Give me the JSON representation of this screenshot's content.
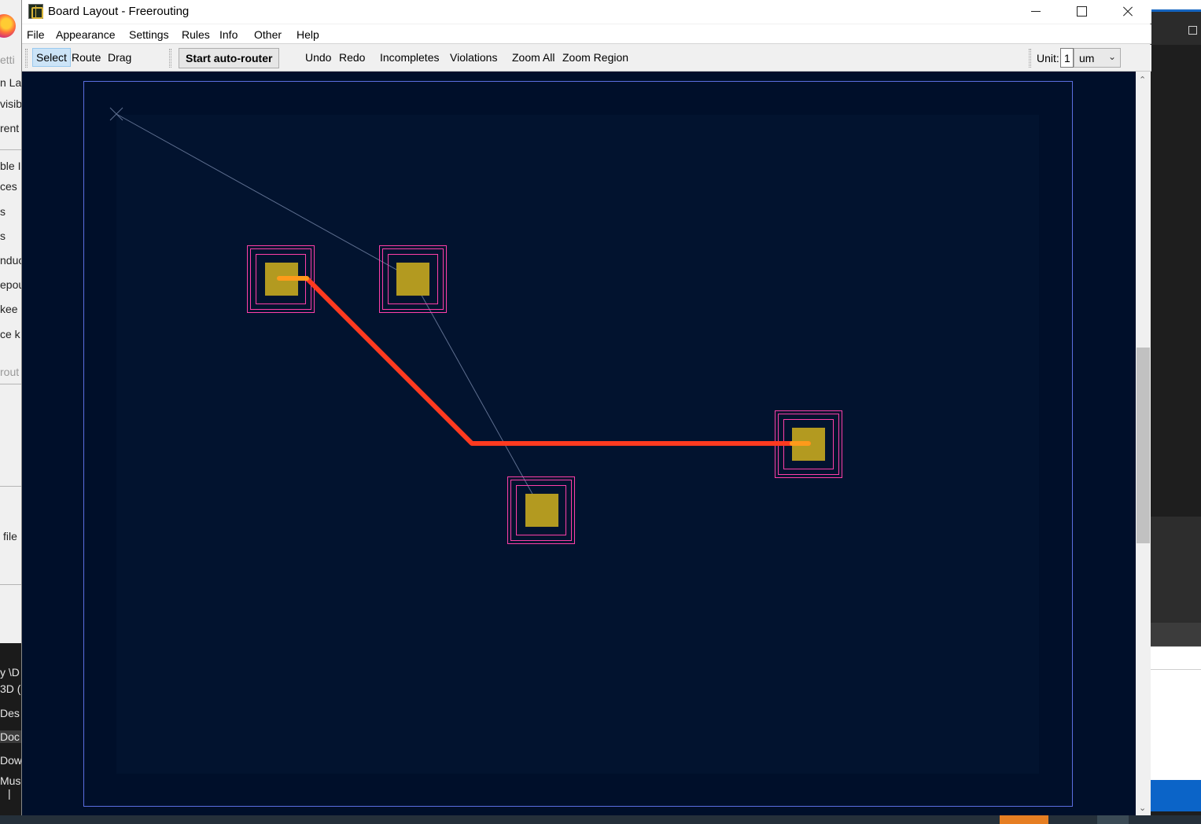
{
  "window": {
    "title": "Board Layout - Freerouting",
    "controls": {
      "minimize": "minimize-icon",
      "maximize": "maximize-icon",
      "close": "close-icon"
    }
  },
  "menu": [
    "File",
    "Appearance",
    "Settings",
    "Rules",
    "Info",
    "Other",
    "Help"
  ],
  "toolbar": {
    "modes": {
      "select": "Select",
      "route": "Route",
      "drag": "Drag",
      "active": "Select"
    },
    "autorouter": "Start auto-router",
    "undo": "Undo",
    "redo": "Redo",
    "incompletes": "Incompletes",
    "violations": "Violations",
    "zoom_all": "Zoom All",
    "zoom_region": "Zoom Region",
    "unit_label": "Unit:",
    "unit_value": "1",
    "unit_selected": "um"
  },
  "board": {
    "background_color": "#000f2a",
    "outline_color": "#5a6ee0",
    "pad_color": "#b39a20",
    "keepout_color": "#ff3fa8",
    "trace_color": "#ff3a1f",
    "ratsnest_color": "#6a7aa0",
    "pads": 4,
    "traces": 1
  },
  "background_fragments": {
    "left": [
      "etti",
      "n La",
      "visibl",
      "rent",
      "ble I",
      "ces",
      "s",
      "s",
      "nduc",
      "epou",
      "kee",
      "ce k",
      "rout",
      "file"
    ],
    "left_dark": [
      "y \\D",
      "3D (",
      "Des",
      "Doc",
      "Dow",
      "Mus",
      "|"
    ]
  }
}
